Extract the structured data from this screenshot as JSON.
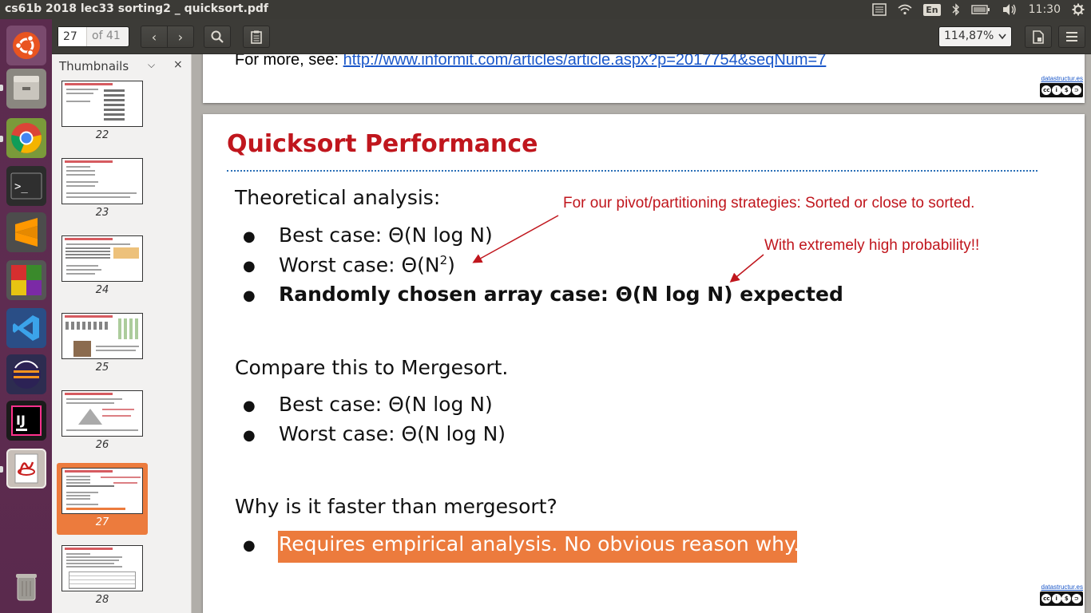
{
  "window": {
    "title": "cs61b 2018 lec33 sorting2 _ quicksort.pdf"
  },
  "tray": {
    "language": "En",
    "clock": "11:30"
  },
  "launcher": {
    "items": [
      "Ubuntu Dash",
      "Files",
      "Chrome",
      "Terminal",
      "Sublime Text",
      "LibreOffice",
      "VS Code",
      "Eclipse",
      "IntelliJ IDEA",
      "Document Viewer",
      "Trash"
    ]
  },
  "toolbar": {
    "page_value": "27",
    "page_total": "of 41",
    "zoom": "114,87%"
  },
  "sidebar": {
    "title": "Thumbnails",
    "thumbnails": [
      {
        "num": "22"
      },
      {
        "num": "23"
      },
      {
        "num": "24"
      },
      {
        "num": "25"
      },
      {
        "num": "26"
      },
      {
        "num": "27"
      },
      {
        "num": "28"
      }
    ],
    "selected": "27"
  },
  "prev_page": {
    "more_prefix": "For more, see: ",
    "more_link": "http://www.informit.com/articles/article.aspx?p=2017754&seqNum=7",
    "badge_link": "datastructur.es"
  },
  "slide": {
    "title": "Quicksort Performance",
    "theoretical": "Theoretical analysis:",
    "best": "Best case: Θ(N log N)",
    "worst_prefix": "Worst case: Θ(N",
    "worst_sup": "2",
    "worst_suffix": ")",
    "random": "Randomly chosen array case: Θ(N log N) expected",
    "annot_sorted": "For our pivot/partitioning strategies: Sorted or close to sorted.",
    "annot_prob": "With extremely high probability!!",
    "compare": "Compare this to Mergesort.",
    "m_best": "Best case: Θ(N log N)",
    "m_worst": "Worst case: Θ(N log N)",
    "why": "Why is it faster than mergesort?",
    "answer": "Requires empirical analysis. No obvious reason why.",
    "badge_link": "datastructur.es"
  },
  "colors": {
    "accent": "#c0161d",
    "highlight": "#ec7b3d",
    "link": "#1a57c9"
  }
}
